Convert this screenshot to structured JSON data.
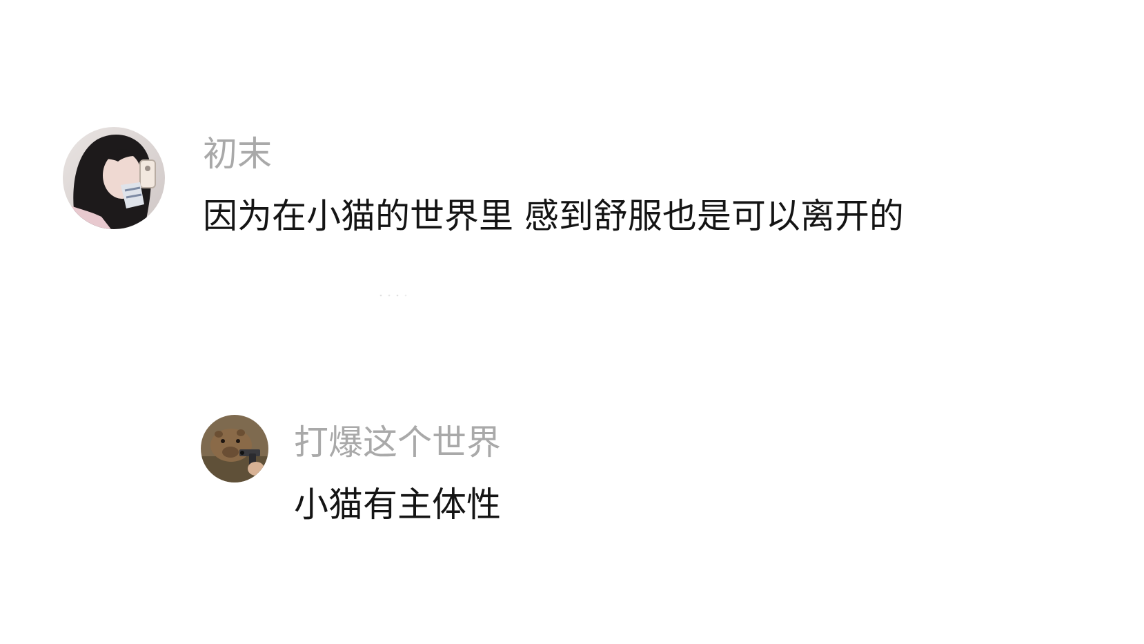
{
  "comments": [
    {
      "username": "初末",
      "text": "因为在小猫的世界里 感到舒服也是可以离开的",
      "avatar_icon": "girl-photo-avatar"
    }
  ],
  "replies": [
    {
      "username": "打爆这个世界",
      "text": "小猫有主体性",
      "avatar_icon": "capybara-with-gun-avatar"
    }
  ],
  "colors": {
    "username": "#a9a9a9",
    "text": "#141414",
    "background": "#ffffff"
  }
}
